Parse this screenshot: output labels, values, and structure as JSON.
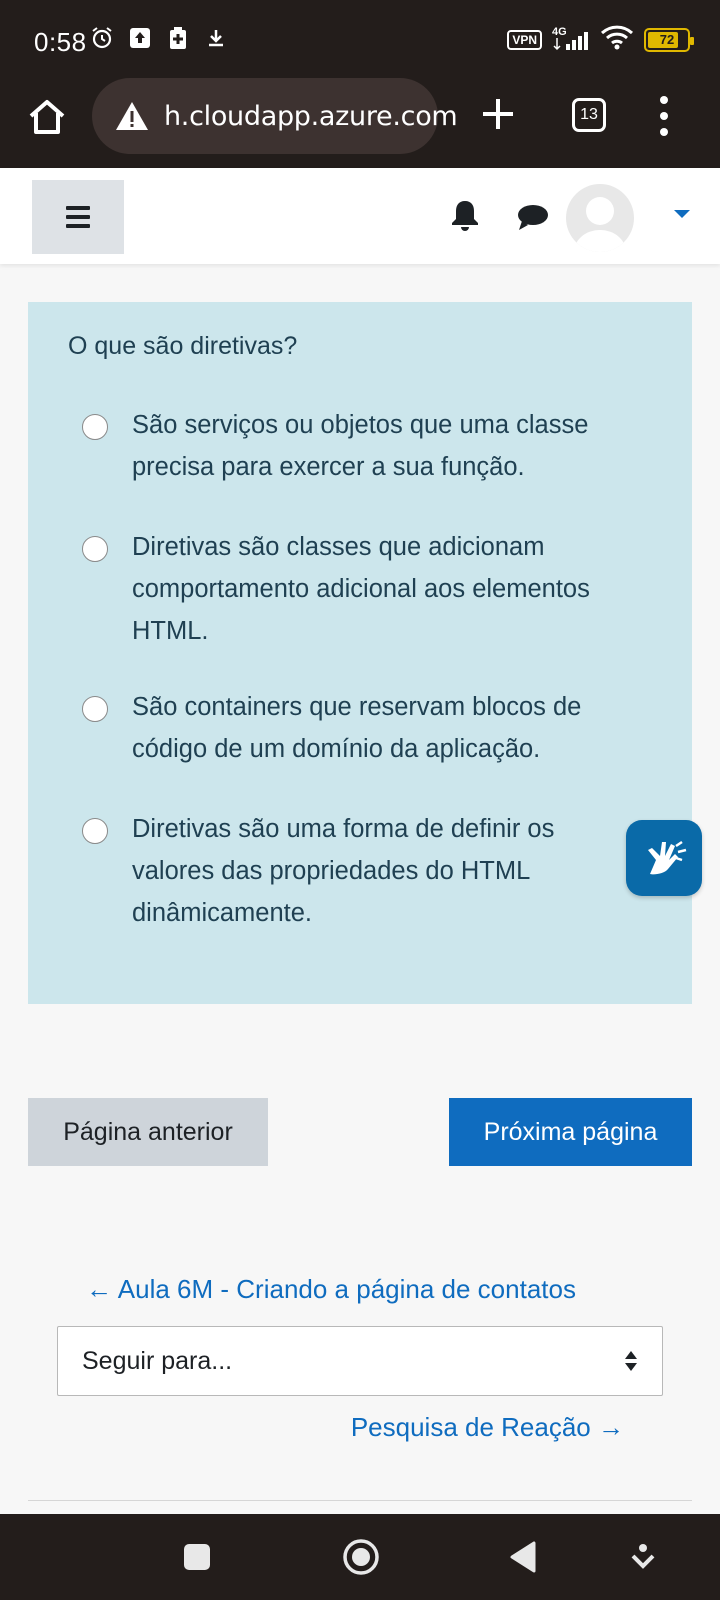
{
  "status_bar": {
    "time": "0:58",
    "vpn": "VPN",
    "network": "4G",
    "battery": "72",
    "battery_level": 0.72
  },
  "browser": {
    "url": "h.cloudapp.azure.com",
    "tab_count": "13",
    "icons": [
      "home-icon",
      "warning-icon",
      "plus-icon",
      "tabs-icon",
      "more-vert-icon"
    ]
  },
  "navbar": {
    "icons": [
      "menu-icon",
      "bell-icon",
      "chat-icon",
      "avatar",
      "caret-down-icon"
    ]
  },
  "question": {
    "text": "O que são diretivas?",
    "options": [
      {
        "label": "São serviços ou objetos que uma classe precisa para exercer a sua função.",
        "selected": false
      },
      {
        "label": "Diretivas são classes que adicionam comportamento adicional aos elementos HTML.",
        "selected": false
      },
      {
        "label": "São containers que reservam blocos de código de um domínio da aplicação.",
        "selected": false
      },
      {
        "label": "Diretivas são uma forma de definir os valores das propriedades do HTML dinâmicamente.",
        "selected": false
      }
    ]
  },
  "buttons": {
    "prev": "Página anterior",
    "next": "Próxima página"
  },
  "activity_nav": {
    "prev_link": "← Aula 6M - Criando a página de contatos",
    "jump_to": "Seguir para...",
    "next_link": "Pesquisa de Reação →"
  },
  "colors": {
    "question_bg": "#cce6ec",
    "primary": "#0f6cbf",
    "secondary": "#ced4da",
    "accessibility_widget": "#0a6aa8"
  }
}
